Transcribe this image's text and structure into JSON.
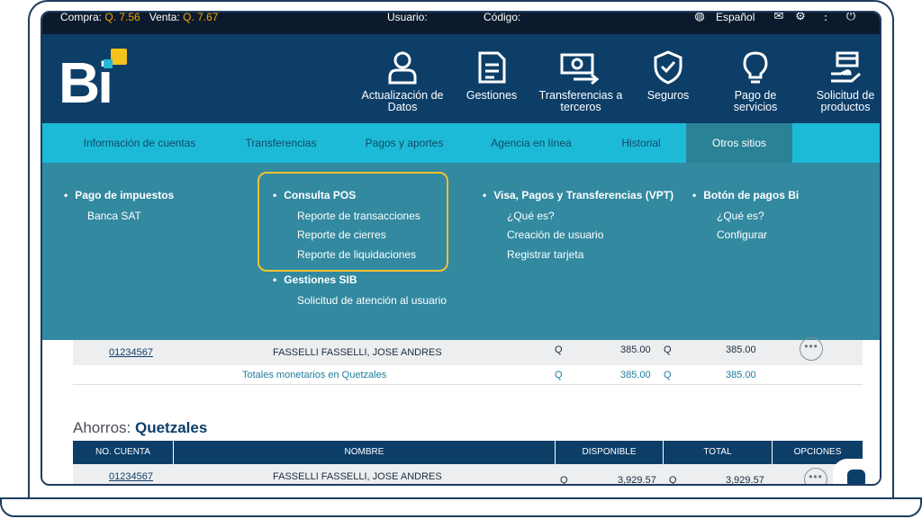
{
  "util_bar": {
    "compra_label": "Compra:",
    "compra_value": "Q. 7.56",
    "venta_label": "Venta:",
    "venta_value": "Q. 7.67",
    "usuario_label": "Usuario:",
    "codigo_label": "Código:",
    "language": "Español"
  },
  "nav": {
    "items": [
      {
        "label": "Actualización de Datos",
        "icon": "user-icon"
      },
      {
        "label": "Gestiones",
        "icon": "document-icon"
      },
      {
        "label": "Transferencias a terceros",
        "icon": "money-transfer-icon"
      },
      {
        "label": "Seguros",
        "icon": "shield-check-icon"
      },
      {
        "label": "Pago de servicios",
        "icon": "lightbulb-icon"
      },
      {
        "label": "Solicitud de productos",
        "icon": "hand-card-icon"
      }
    ]
  },
  "tabs": [
    {
      "label": "Información de cuentas"
    },
    {
      "label": "Transferencias"
    },
    {
      "label": "Pagos y aportes"
    },
    {
      "label": "Agencia en línea"
    },
    {
      "label": "Historial"
    },
    {
      "label": "Otros sitios"
    }
  ],
  "panel": {
    "col1": {
      "header": "Pago de impuestos",
      "links": [
        "Banca SAT"
      ]
    },
    "col2": {
      "header": "Consulta POS",
      "links": [
        "Reporte de transacciones",
        "Reporte de cierres",
        "Reporte de liquidaciones"
      ],
      "header2": "Gestiones SIB",
      "links2": [
        "Solicitud de atención al usuario"
      ]
    },
    "col3": {
      "header": "Visa, Pagos y Transferencias (VPT)",
      "links": [
        "¿Qué es?",
        "Creación de usuario",
        "Registrar tarjeta"
      ]
    },
    "col4": {
      "header": "Botón de pagos Bi",
      "links": [
        "¿Qué es?",
        "Configurar"
      ]
    }
  },
  "monetarios": {
    "row": {
      "account": "01234567",
      "name": "FASSELLI FASSELLI, JOSE ANDRES",
      "cur1": "Q",
      "disponible": "385.00",
      "cur2": "Q",
      "total": "385.00"
    },
    "totals": {
      "label": "Totales monetarios en Quetzales",
      "cur1": "Q",
      "disponible": "385.00",
      "cur2": "Q",
      "total": "385.00"
    }
  },
  "ahorros": {
    "title_prefix": "Ahorros:",
    "title_currency": "Quetzales",
    "headers": [
      "NO. CUENTA",
      "NOMBRE",
      "DISPONIBLE",
      "TOTAL",
      "OPCIONES"
    ],
    "row": {
      "account": "01234567",
      "name": "FASSELLI FASSELLI, JOSE ANDRES",
      "cur1": "Q",
      "disponible": "3,929.57",
      "cur2": "Q",
      "total": "3,929.57"
    }
  },
  "colors": {
    "header": "#0c3e68",
    "tabs": "#1dbad7",
    "panel": "#3289a0",
    "highlight": "#f2c230"
  }
}
